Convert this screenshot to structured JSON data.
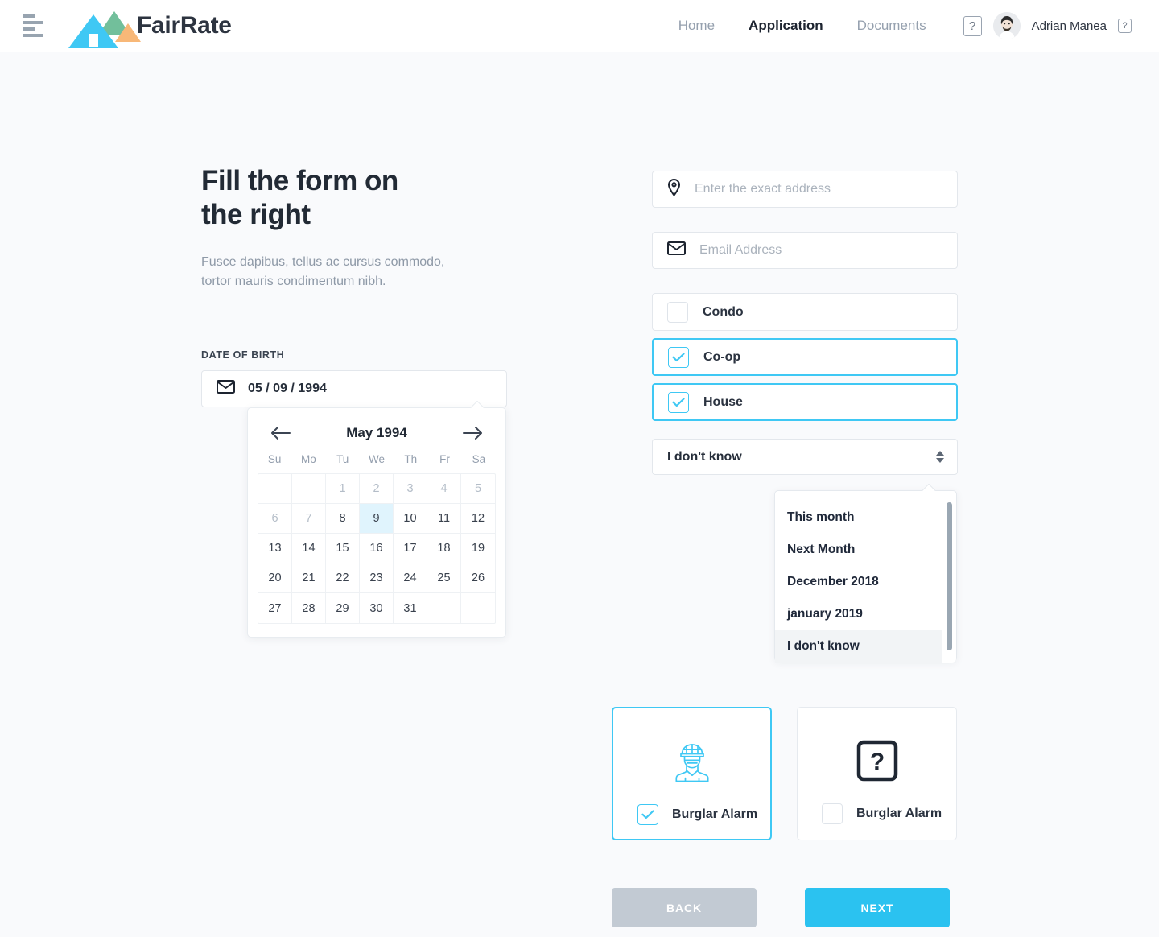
{
  "brand": {
    "name": "FairRate",
    "menu_icon": "hamburger-icon"
  },
  "nav": {
    "links": [
      {
        "label": "Home",
        "active": false
      },
      {
        "label": "Application",
        "active": true
      },
      {
        "label": "Documents",
        "active": false
      }
    ],
    "help_icon_large": "?",
    "help_icon_small": "?",
    "user_name": "Adrian Manea"
  },
  "left": {
    "headline_line1": "Fill the form on",
    "headline_line2": "the right",
    "subtext_line1": "Fusce dapibus, tellus ac cursus commodo,",
    "subtext_line2": "tortor mauris condimentum nibh.",
    "dob_label": "DATE OF BIRTH",
    "dob_value": "05 / 09 / 1994",
    "dob_icon": "envelope-icon"
  },
  "calendar": {
    "title": "May 1994",
    "prev_icon": "arrow-left-icon",
    "next_icon": "arrow-right-icon",
    "weekdays": [
      "Su",
      "Mo",
      "Tu",
      "We",
      "Th",
      "Fr",
      "Sa"
    ],
    "cells": [
      {
        "label": "",
        "state": "empty"
      },
      {
        "label": "",
        "state": "empty"
      },
      {
        "label": "1",
        "state": "dim"
      },
      {
        "label": "2",
        "state": "dim"
      },
      {
        "label": "3",
        "state": "dim"
      },
      {
        "label": "4",
        "state": "dim"
      },
      {
        "label": "5",
        "state": "dim"
      },
      {
        "label": "6",
        "state": "dim"
      },
      {
        "label": "7",
        "state": "dim"
      },
      {
        "label": "8",
        "state": "normal"
      },
      {
        "label": "9",
        "state": "selected"
      },
      {
        "label": "10",
        "state": "normal"
      },
      {
        "label": "11",
        "state": "normal"
      },
      {
        "label": "12",
        "state": "normal"
      },
      {
        "label": "13",
        "state": "normal"
      },
      {
        "label": "14",
        "state": "normal"
      },
      {
        "label": "15",
        "state": "normal"
      },
      {
        "label": "16",
        "state": "normal"
      },
      {
        "label": "17",
        "state": "normal"
      },
      {
        "label": "18",
        "state": "normal"
      },
      {
        "label": "19",
        "state": "normal"
      },
      {
        "label": "20",
        "state": "normal"
      },
      {
        "label": "21",
        "state": "normal"
      },
      {
        "label": "22",
        "state": "normal"
      },
      {
        "label": "23",
        "state": "normal"
      },
      {
        "label": "24",
        "state": "normal"
      },
      {
        "label": "25",
        "state": "normal"
      },
      {
        "label": "26",
        "state": "normal"
      },
      {
        "label": "27",
        "state": "normal"
      },
      {
        "label": "28",
        "state": "normal"
      },
      {
        "label": "29",
        "state": "normal"
      },
      {
        "label": "30",
        "state": "normal"
      },
      {
        "label": "31",
        "state": "normal"
      },
      {
        "label": "",
        "state": "empty"
      },
      {
        "label": "",
        "state": "empty"
      }
    ],
    "selected_day": "9"
  },
  "form": {
    "address": {
      "placeholder": "Enter the exact address",
      "value": "",
      "icon": "location-pin-icon"
    },
    "email": {
      "placeholder": "Email Address",
      "value": "",
      "icon": "envelope-icon"
    },
    "property_types": [
      {
        "label": "Condo",
        "checked": false
      },
      {
        "label": "Co-op",
        "checked": true
      },
      {
        "label": "House",
        "checked": true
      }
    ],
    "timing_select": {
      "value": "I don't know",
      "stepper_icon": "stepper-updown-icon",
      "options": [
        {
          "label": "This month",
          "selected": false
        },
        {
          "label": "Next Month",
          "selected": false
        },
        {
          "label": "December 2018",
          "selected": false
        },
        {
          "label": "january 2019",
          "selected": false
        },
        {
          "label": "I don't know",
          "selected": true
        }
      ]
    },
    "feature_cards": [
      {
        "label": "Burglar Alarm",
        "checked": true,
        "icon": "burglar-icon",
        "selected": true
      },
      {
        "label": "Burglar Alarm",
        "checked": false,
        "icon": "question-box-icon",
        "selected": false
      }
    ]
  },
  "actions": {
    "back_label": "BACK",
    "next_label": "NEXT"
  },
  "colors": {
    "accent": "#3fc8f4",
    "next_button": "#2bc2f0",
    "back_button": "#c2cad3",
    "logo_blue": "#3fc8f4",
    "logo_green": "#72bf9b",
    "logo_orange": "#f8b878",
    "selected_day_bg": "#e0f4fd",
    "page_bg": "#f9fafc"
  }
}
